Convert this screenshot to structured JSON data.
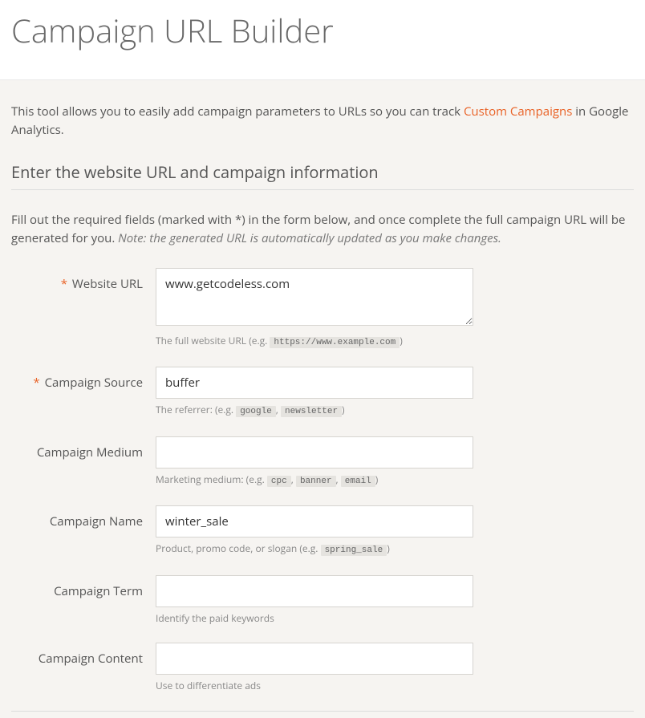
{
  "header": {
    "title": "Campaign URL Builder"
  },
  "intro": {
    "prefix": "This tool allows you to easily add campaign parameters to URLs so you can track ",
    "link_text": "Custom Campaigns",
    "suffix": " in Google Analytics."
  },
  "section": {
    "title": "Enter the website URL and campaign information",
    "desc_prefix": "Fill out the required fields (marked with *) in the form below, and once complete the full campaign URL will be generated for you. ",
    "desc_note": "Note: the generated URL is automatically updated as you make changes."
  },
  "fields": {
    "website_url": {
      "label": "Website URL",
      "value": "www.getcodeless.com",
      "hint_prefix": "The full website URL (e.g. ",
      "hint_code1": "https://www.example.com",
      "hint_suffix": ")"
    },
    "source": {
      "label": "Campaign Source",
      "value": "buffer",
      "hint_prefix": "The referrer: (e.g. ",
      "hint_code1": "google",
      "hint_sep1": ", ",
      "hint_code2": "newsletter",
      "hint_suffix": ")"
    },
    "medium": {
      "label": "Campaign Medium",
      "value": "",
      "hint_prefix": "Marketing medium: (e.g. ",
      "hint_code1": "cpc",
      "hint_sep1": ", ",
      "hint_code2": "banner",
      "hint_sep2": ", ",
      "hint_code3": "email",
      "hint_suffix": ")"
    },
    "name": {
      "label": "Campaign Name",
      "value": "winter_sale",
      "hint_prefix": "Product, promo code, or slogan (e.g. ",
      "hint_code1": "spring_sale",
      "hint_suffix": ")"
    },
    "term": {
      "label": "Campaign Term",
      "value": "",
      "hint": "Identify the paid keywords"
    },
    "content": {
      "label": "Campaign Content",
      "value": "",
      "hint": "Use to differentiate ads"
    }
  }
}
